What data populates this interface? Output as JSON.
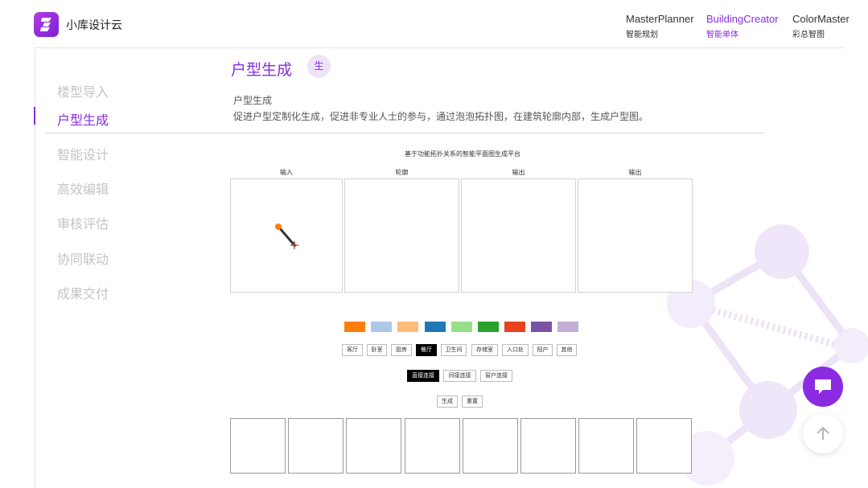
{
  "header": {
    "brand": "小库设计云",
    "nav": [
      {
        "en": "MasterPlanner",
        "cn": "智能规划",
        "active": false
      },
      {
        "en": "BuildingCreator",
        "cn": "智能单体",
        "active": true
      },
      {
        "en": "ColorMaster",
        "cn": "彩总智图",
        "active": false
      }
    ]
  },
  "sidebar": {
    "items": [
      {
        "label": "楼型导入"
      },
      {
        "label": "户型生成",
        "active": true
      },
      {
        "label": "智能设计"
      },
      {
        "label": "高效编辑"
      },
      {
        "label": "审核评估"
      },
      {
        "label": "协同联动"
      },
      {
        "label": "成果交付"
      }
    ]
  },
  "section": {
    "title": "户型生成",
    "badge": "生",
    "subtitle": "户型生成",
    "description": "促进户型定制化生成，促进非专业人士的参与，通过泡泡拓扑图，在建筑轮廓内部，生成户型图。"
  },
  "demo": {
    "title": "基于功能拓扑关系的智能平面图生成平台",
    "panels": [
      "输入",
      "轮廓",
      "输出",
      "输出"
    ],
    "swatches": [
      "#ff7f0e",
      "#aec7e8",
      "#ffbb78",
      "#1f77b4",
      "#98df8a",
      "#2ca02c",
      "#e8431e",
      "#7b53a6",
      "#c5b0d5"
    ],
    "rooms": [
      "客厅",
      "卧室",
      "厨房",
      "餐厅",
      "卫生间",
      "存储室",
      "入口处",
      "阳户",
      "其他"
    ],
    "active_room": "餐厅",
    "connections": [
      "直接连接",
      "间接连接",
      "窗户连接"
    ],
    "active_connection": "直接连接",
    "actions": [
      "生成",
      "重置"
    ]
  },
  "icons": {
    "logo": "logo-icon",
    "chat": "chat-icon",
    "back_to_top": "arrow-up-icon",
    "cursor": "pen-cursor-icon"
  },
  "colors": {
    "accent": "#8a2be2",
    "sidebar_inactive": "#c4c4c4"
  }
}
